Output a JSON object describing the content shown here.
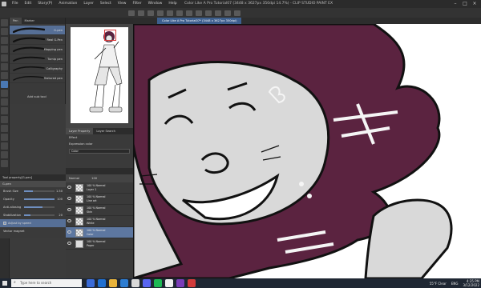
{
  "window": {
    "menu": [
      "File",
      "Edit",
      "Story(P)",
      "Animation",
      "Layer",
      "Select",
      "View",
      "Filter",
      "Window",
      "Help"
    ],
    "document_title": "Color Like A Pro Tutorial07 (3448 x 3627px 350dpi 14.7%) - CLIP STUDIO PAINT EX"
  },
  "subtool": {
    "tabs": [
      "Pen",
      "Marker"
    ],
    "items": [
      {
        "label": "G-pen",
        "selected": true
      },
      {
        "label": "Real G-Pen",
        "selected": false
      },
      {
        "label": "Mapping pen",
        "selected": false
      },
      {
        "label": "Turnip pen",
        "selected": false
      },
      {
        "label": "Calligraphy",
        "selected": false
      },
      {
        "label": "Textured pen",
        "selected": false
      }
    ],
    "add_label": "Add sub tool"
  },
  "tool_property": {
    "header": "Tool property[G-pen]",
    "name": "G-pen",
    "rows": [
      {
        "label": "Brush Size",
        "value": "1.50",
        "fill": 0.3
      },
      {
        "label": "Opacity",
        "value": "100",
        "fill": 1.0
      },
      {
        "label": "Anti-aliasing",
        "value": "",
        "fill": 0.6
      },
      {
        "label": "Stabilization",
        "value": "20",
        "fill": 0.2
      }
    ],
    "adjust_speed_label": "Adjust by speed",
    "vector_magnet_label": "Vector magnet"
  },
  "mid_panel": {
    "tabs": [
      "Layer Property",
      "Layer Search"
    ],
    "effect_label": "Effect",
    "expression_label": "Expression color",
    "expression_value": "Color"
  },
  "layers": {
    "blend_mode": "Normal",
    "opacity": "100",
    "items": [
      {
        "line1": "100 % Normal",
        "line2": "Layer 1",
        "thumb": "checker",
        "active": false
      },
      {
        "line1": "100 % Normal",
        "line2": "Line art",
        "thumb": "checker",
        "active": false
      },
      {
        "line1": "100 % Normal",
        "line2": "Skin",
        "thumb": "checker",
        "active": false
      },
      {
        "line1": "100 % Normal",
        "line2": "White",
        "thumb": "checker",
        "active": false
      },
      {
        "line1": "100 % Normal",
        "line2": "Color",
        "thumb": "checker",
        "active": true
      },
      {
        "line1": "100 % Normal",
        "line2": "Paper",
        "thumb": "paper",
        "active": false
      }
    ]
  },
  "canvas": {
    "tab_label": "Color Like A Pro Tutorial07* (3448 x 3627px 350dpi)",
    "hair_color": "#5b2340",
    "skin_color": "#d9d9d9"
  },
  "taskbar": {
    "search_placeholder": "Type here to search",
    "weather": "55°F Clear",
    "lang": "ENG",
    "time": "4:35 PM",
    "date": "3/12/2022"
  },
  "colors": {
    "main": "#5b2340",
    "sub": "#ffffff",
    "accent": "#566f96"
  }
}
